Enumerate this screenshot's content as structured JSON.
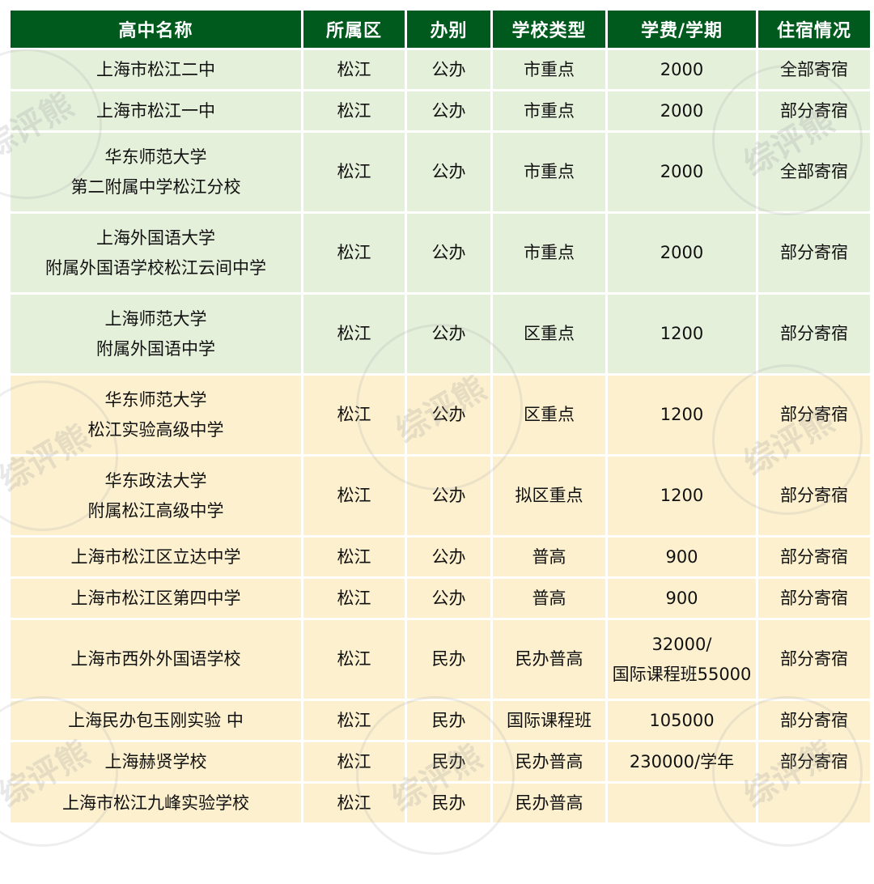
{
  "table": {
    "headers": [
      "高中名称",
      "所属区",
      "办别",
      "学校类型",
      "学费/学期",
      "住宿情况"
    ],
    "rows": [
      {
        "band": "green",
        "h": 48,
        "name": [
          "上海市松江二中"
        ],
        "district": "松江",
        "type": "公办",
        "category": "市重点",
        "fee": [
          "2000"
        ],
        "board": "全部寄宿"
      },
      {
        "band": "green",
        "h": 48,
        "name": [
          "上海市松江一中"
        ],
        "district": "松江",
        "type": "公办",
        "category": "市重点",
        "fee": [
          "2000"
        ],
        "board": "部分寄宿"
      },
      {
        "band": "green",
        "h": 97,
        "name": [
          "华东师范大学",
          "第二附属中学松江分校"
        ],
        "district": "松江",
        "type": "公办",
        "category": "市重点",
        "fee": [
          "2000"
        ],
        "board": "全部寄宿"
      },
      {
        "band": "green",
        "h": 97,
        "name": [
          "上海外国语大学",
          "附属外国语学校松江云间中学"
        ],
        "district": "松江",
        "type": "公办",
        "category": "市重点",
        "fee": [
          "2000"
        ],
        "board": "部分寄宿"
      },
      {
        "band": "green",
        "h": 97,
        "name": [
          "上海师范大学",
          "附属外国语中学"
        ],
        "district": "松江",
        "type": "公办",
        "category": "区重点",
        "fee": [
          "1200"
        ],
        "board": "部分寄宿"
      },
      {
        "band": "yellow",
        "h": 97,
        "name": [
          "华东师范大学",
          "松江实验高级中学"
        ],
        "district": "松江",
        "type": "公办",
        "category": "区重点",
        "fee": [
          "1200"
        ],
        "board": "部分寄宿"
      },
      {
        "band": "yellow",
        "h": 97,
        "name": [
          "华东政法大学",
          "附属松江高级中学"
        ],
        "district": "松江",
        "type": "公办",
        "category": "拟区重点",
        "fee": [
          "1200"
        ],
        "board": "部分寄宿"
      },
      {
        "band": "yellow",
        "h": 48,
        "name": [
          "上海市松江区立达中学"
        ],
        "district": "松江",
        "type": "公办",
        "category": "普高",
        "fee": [
          "900"
        ],
        "board": "部分寄宿"
      },
      {
        "band": "yellow",
        "h": 48,
        "name": [
          "上海市松江区第四中学"
        ],
        "district": "松江",
        "type": "公办",
        "category": "普高",
        "fee": [
          "900"
        ],
        "board": "部分寄宿"
      },
      {
        "band": "yellow",
        "h": 97,
        "name": [
          "上海市西外外国语学校"
        ],
        "district": "松江",
        "type": "民办",
        "category": "民办普高",
        "fee": [
          "32000/",
          "国际课程班55000"
        ],
        "board": "部分寄宿"
      },
      {
        "band": "yellow",
        "h": 48,
        "name": [
          "上海民办包玉刚实验 中"
        ],
        "district": "松江",
        "type": "民办",
        "category": "国际课程班",
        "fee": [
          "105000"
        ],
        "board": "部分寄宿"
      },
      {
        "band": "yellow",
        "h": 48,
        "name": [
          "上海赫贤学校"
        ],
        "district": "松江",
        "type": "民办",
        "category": "民办普高",
        "fee": [
          "230000/学年"
        ],
        "board": "部分寄宿"
      },
      {
        "band": "yellow",
        "h": 48,
        "name": [
          "上海市松江九峰实验学校"
        ],
        "district": "松江",
        "type": "民办",
        "category": "民办普高",
        "fee": [
          ""
        ],
        "board": ""
      }
    ]
  },
  "watermark": {
    "text": "综评熊"
  }
}
